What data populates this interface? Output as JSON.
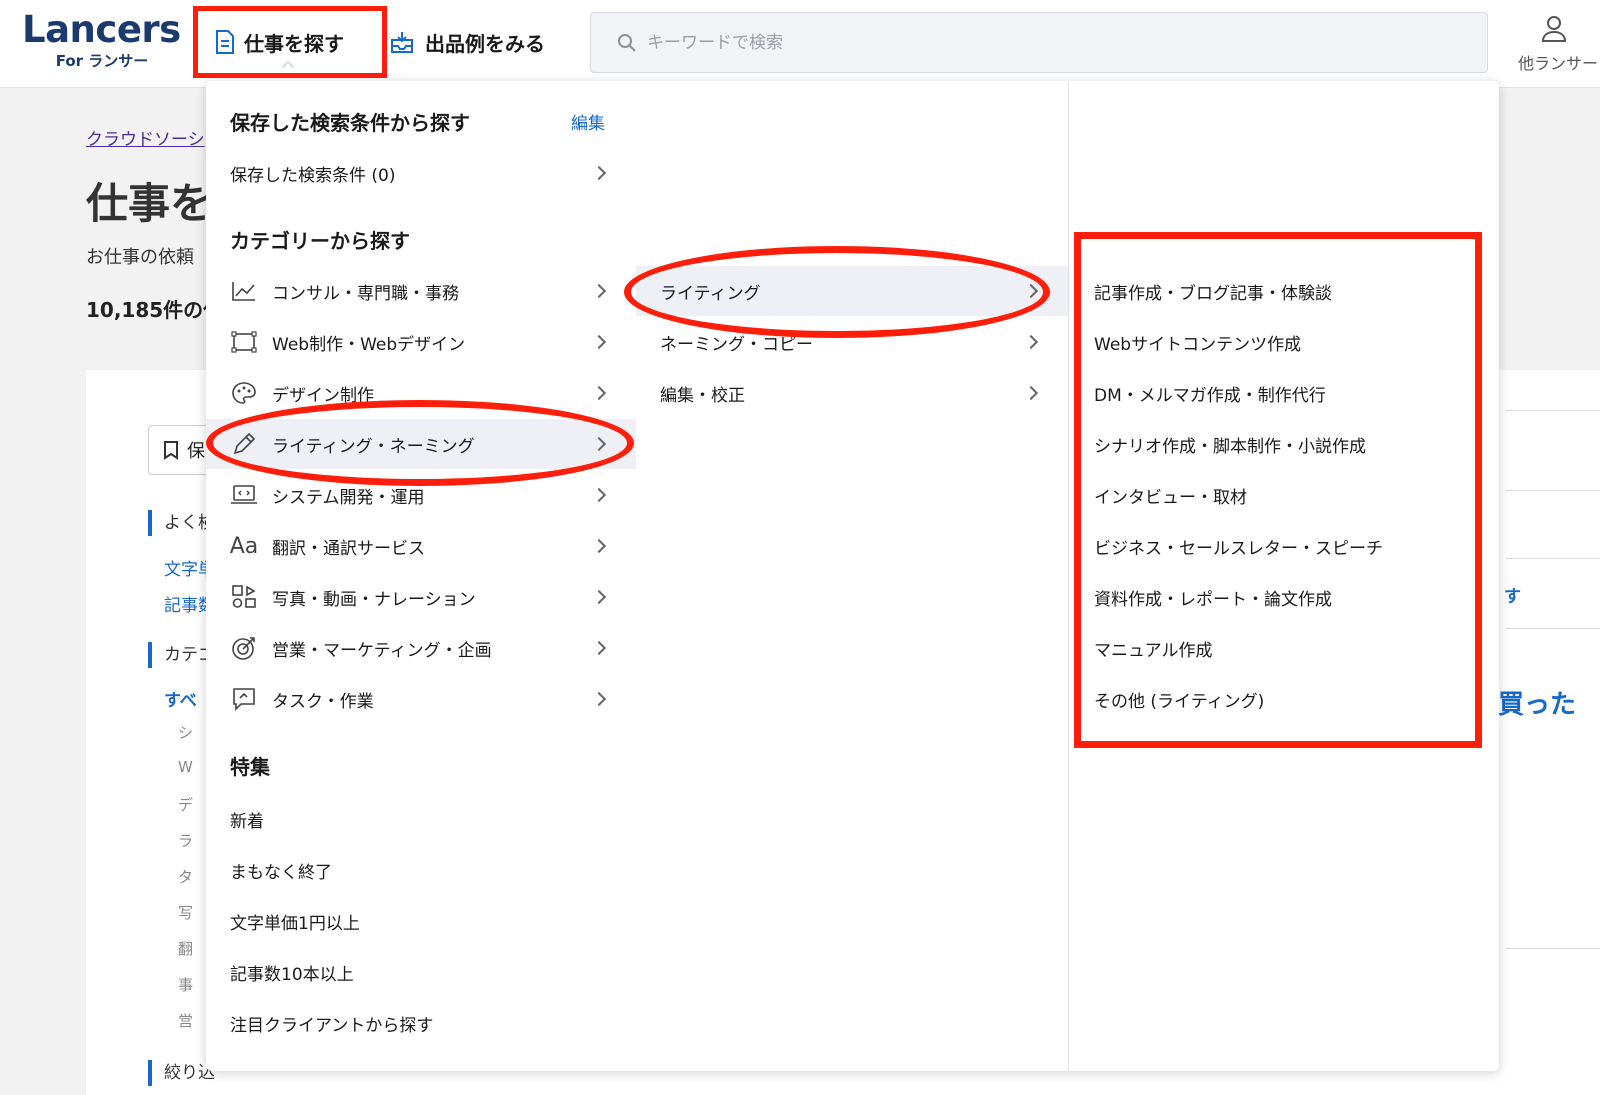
{
  "header": {
    "logo_main": "Lancers",
    "logo_sub": "For ランサー",
    "nav_find": "仕事を探す",
    "nav_examples": "出品例をみる",
    "search_placeholder": "キーワードで検索",
    "user_label": "他ランサー"
  },
  "background": {
    "breadcrumb": "クラウドソーシ",
    "title": "仕事を",
    "desc": "お仕事の依頼",
    "count": "10,185件の仕",
    "save_label": "保",
    "side_head_1": "よく検",
    "side_link_1": "文字単",
    "side_link_2": "記事数",
    "side_head_2": "カテゴ",
    "side_link_3": "すべ",
    "side_head_3": "絞り込",
    "tree_items": [
      "シ",
      "W",
      "デ",
      "ラ",
      "タ",
      "写",
      "翻",
      "事",
      "営"
    ],
    "right_link": "す",
    "right_big": "買った"
  },
  "menu": {
    "saved_title": "保存した検索条件から探す",
    "edit_label": "編集",
    "saved_item": "保存した検索条件 (0)",
    "category_title": "カテゴリーから探す",
    "categories": [
      {
        "label": "コンサル・専門職・事務",
        "icon": "chart-icon"
      },
      {
        "label": "Web制作・Webデザイン",
        "icon": "web-layout-icon"
      },
      {
        "label": "デザイン制作",
        "icon": "palette-icon"
      },
      {
        "label": "ライティング・ネーミング",
        "icon": "pen-icon"
      },
      {
        "label": "システム開発・運用",
        "icon": "laptop-icon"
      },
      {
        "label": "翻訳・通訳サービス",
        "icon": "translate-icon"
      },
      {
        "label": "写真・動画・ナレーション",
        "icon": "media-icon"
      },
      {
        "label": "営業・マーケティング・企画",
        "icon": "target-icon"
      },
      {
        "label": "タスク・作業",
        "icon": "task-icon"
      }
    ],
    "subcategories": [
      "ライティング",
      "ネーミング・コピー",
      "編集・校正"
    ],
    "leaf_items": [
      "記事作成・ブログ記事・体験談",
      "Webサイトコンテンツ作成",
      "DM・メルマガ作成・制作代行",
      "シナリオ作成・脚本制作・小説作成",
      "インタビュー・取材",
      "ビジネス・セールスレター・スピーチ",
      "資料作成・レポート・論文作成",
      "マニュアル作成",
      "その他 (ライティング)"
    ],
    "feature_title": "特集",
    "features": [
      "新着",
      "まもなく終了",
      "文字単価1円以上",
      "記事数10本以上",
      "注目クライアントから探す"
    ]
  },
  "colors": {
    "annotation": "#ff1e0a",
    "link": "#1769c9",
    "logo": "#1b3a6e",
    "highlight": "#eef0f6"
  }
}
